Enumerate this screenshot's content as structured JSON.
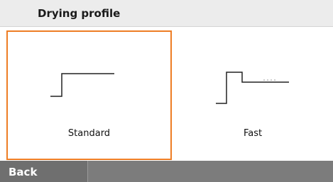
{
  "header": {
    "title": "Drying profile"
  },
  "profiles": [
    {
      "label": "Standard",
      "icon": "standard-profile-step-icon",
      "selected": true
    },
    {
      "label": "Fast",
      "icon": "fast-profile-step-icon",
      "selected": false
    }
  ],
  "footer": {
    "back_label": "Back"
  },
  "colors": {
    "accent": "#ee7d24",
    "header_bg": "#ececec",
    "footer_bg": "#7c7c7c",
    "text": "#111111"
  }
}
